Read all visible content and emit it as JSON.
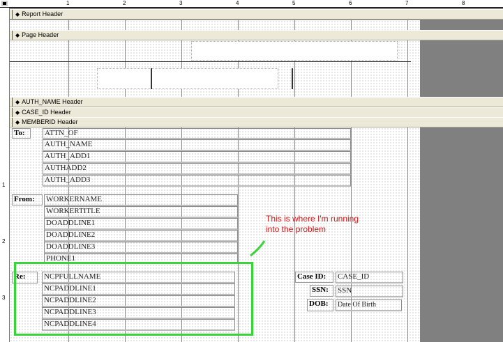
{
  "ruler": {
    "top_numbers": [
      "1",
      "2",
      "3",
      "4",
      "5",
      "6",
      "7",
      "8"
    ],
    "left_numbers": [
      "1",
      "2",
      "3"
    ]
  },
  "sections": {
    "report_header": "Report Header",
    "page_header": "Page Header",
    "auth_name_header": "AUTH_NAME Header",
    "case_id_header": "CASE_ID Header",
    "memberid_header": "MEMBERID Header"
  },
  "detail": {
    "to_label": "To:",
    "to_fields": [
      "ATTN_OF",
      "AUTH_NAME",
      "AUTH_ADD1",
      "AUTHADD2",
      "AUTH_ADD3"
    ],
    "from_label": "From:",
    "from_fields": [
      "WORKERNAME",
      "WORKERTITLE",
      "DOADDLINE1",
      "DOADDLINE2",
      "DOADDLINE3",
      "PHONE1"
    ],
    "re_label": "Re:",
    "re_fields": [
      "NCPFULLNAME",
      "NCPADDLINE1",
      "NCPADDLINE2",
      "NCPADDLINE3",
      "NCPADDLINE4"
    ],
    "case_id_label": "Case ID:",
    "case_id_field": "CASE_ID",
    "ssn_label": "SSN:",
    "ssn_field": "SSN",
    "dob_label": "DOB:",
    "dob_field": "Date Of Birth"
  },
  "annotation": {
    "line1": "This is where I'm running",
    "line2": "into the problem",
    "color": "#d01a1a",
    "highlight_color": "#3ad43a"
  }
}
